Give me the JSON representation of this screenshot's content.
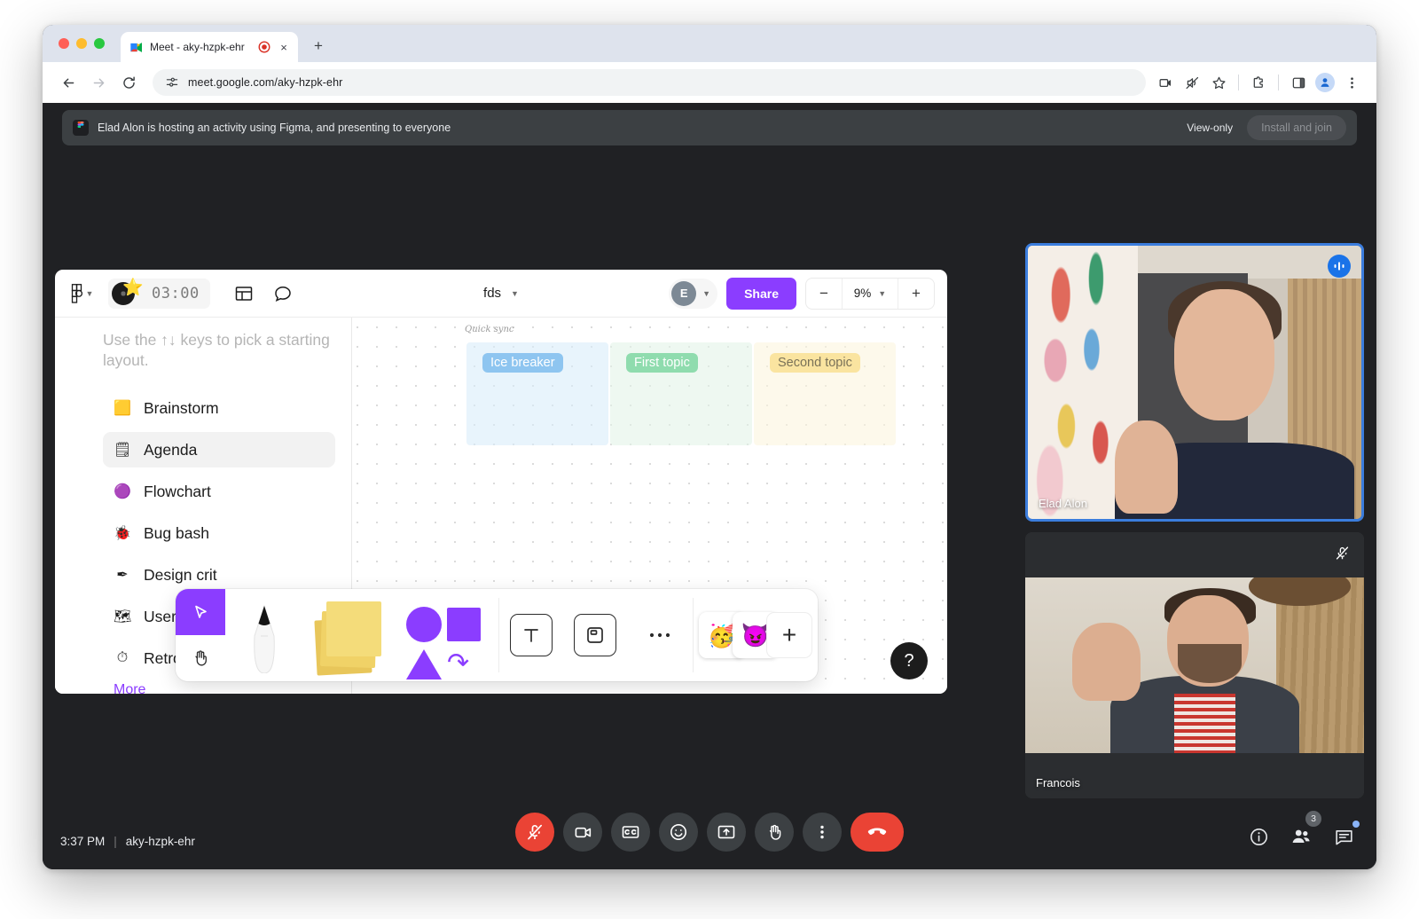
{
  "browser": {
    "tab": {
      "title": "Meet - aky-hzpk-ehr",
      "favicon_name": "meet-favicon",
      "recording_name": "recording-indicator",
      "close_label": "×"
    },
    "new_tab_label": "+",
    "url": "meet.google.com/aky-hzpk-ehr",
    "toolbar_icons": [
      "cast-icon",
      "mute-site-icon",
      "bookmark-star-icon",
      "extensions-icon",
      "side-panel-icon",
      "profile-icon",
      "chrome-menu-icon"
    ]
  },
  "banner": {
    "text": "Elad Alon is hosting an activity using Figma, and presenting to everyone",
    "view_only_label": "View-only",
    "install_button_label": "Install and join",
    "app_icon_name": "figma-icon"
  },
  "figma": {
    "toolbar": {
      "logo_name": "figma-logo-icon",
      "timer": "03:00",
      "timer_icon_name": "music-disc-star-icon",
      "layout_icon_name": "layout-panel-icon",
      "comment_icon_name": "comment-bubble-icon",
      "doc_name": "fds",
      "avatar_initial": "E",
      "share_label": "Share",
      "zoom_minus": "−",
      "zoom_value": "9%",
      "zoom_plus": "+"
    },
    "sidebar": {
      "hint": "Use the ↑↓ keys to pick a starting layout.",
      "items": [
        {
          "label": "Brainstorm",
          "icon": "🟨",
          "icon_name": "sticky-note-icon",
          "active": false
        },
        {
          "label": "Agenda",
          "icon": "🗒",
          "icon_name": "agenda-board-icon",
          "active": true
        },
        {
          "label": "Flowchart",
          "icon": "🟣",
          "icon_name": "flowchart-shapes-icon",
          "active": false
        },
        {
          "label": "Bug bash",
          "icon": "🐞",
          "icon_name": "bug-icon",
          "active": false
        },
        {
          "label": "Design crit",
          "icon": "✒",
          "icon_name": "pen-nib-icon",
          "active": false
        },
        {
          "label": "User journey",
          "icon": "🗺",
          "icon_name": "map-icon",
          "active": false
        },
        {
          "label": "Retro",
          "icon": "⏱",
          "icon_name": "stopwatch-icon",
          "active": false
        }
      ],
      "more_label": "More"
    },
    "canvas": {
      "board_label": "Quick sync",
      "columns": [
        {
          "chip": "Ice breaker"
        },
        {
          "chip": "First topic"
        },
        {
          "chip": "Second topic"
        }
      ]
    },
    "tools": {
      "cursor_icon_name": "cursor-arrow-icon",
      "hand_icon_name": "hand-pan-icon",
      "pen_icon_name": "marker-pen-icon",
      "sticky_icon_name": "sticky-notes-icon",
      "shapes_icon_name": "shapes-icon",
      "text_icon_name": "text-tool-icon",
      "frame_icon_name": "frame-tool-icon",
      "more_icon_name": "more-tools-icon",
      "more_label": "•••",
      "sticker_1_name": "party-face-sticker",
      "sticker_2_name": "party-monster-sticker",
      "add_sticker_label": "+",
      "add_sticker_name": "add-sticker-button"
    },
    "help_label": "?",
    "help_name": "help-button"
  },
  "videos": [
    {
      "name": "Elad Alon",
      "status_icon": "speaking-indicator",
      "speaking": true
    },
    {
      "name": "Francois",
      "status_icon": "muted-mic-icon",
      "speaking": false
    }
  ],
  "meeting": {
    "time": "3:37 PM",
    "divider": "|",
    "code": "aky-hzpk-ehr",
    "controls": [
      {
        "name": "microphone-off-button",
        "icon": "mic-muted-icon",
        "state": "danger"
      },
      {
        "name": "camera-button",
        "icon": "camera-icon",
        "state": "normal"
      },
      {
        "name": "captions-button",
        "icon": "cc-icon",
        "state": "normal"
      },
      {
        "name": "reactions-button",
        "icon": "emoji-smiley-icon",
        "state": "normal"
      },
      {
        "name": "present-button",
        "icon": "present-screen-icon",
        "state": "normal"
      },
      {
        "name": "raise-hand-button",
        "icon": "raise-hand-icon",
        "state": "normal"
      },
      {
        "name": "more-options-button",
        "icon": "kebab-menu-icon",
        "state": "normal"
      },
      {
        "name": "leave-call-button",
        "icon": "hangup-phone-icon",
        "state": "hangup"
      }
    ],
    "right_controls": [
      {
        "name": "meeting-details-button",
        "icon": "info-icon",
        "badge": ""
      },
      {
        "name": "participants-button",
        "icon": "people-icon",
        "badge": "3"
      },
      {
        "name": "chat-button",
        "icon": "chat-icon",
        "badge": ""
      }
    ]
  },
  "colors": {
    "accent_purple": "#8b3dff",
    "meet_red": "#ea4335",
    "speaking_blue": "#1a73e8",
    "tile_border": "#3b7ddd"
  }
}
